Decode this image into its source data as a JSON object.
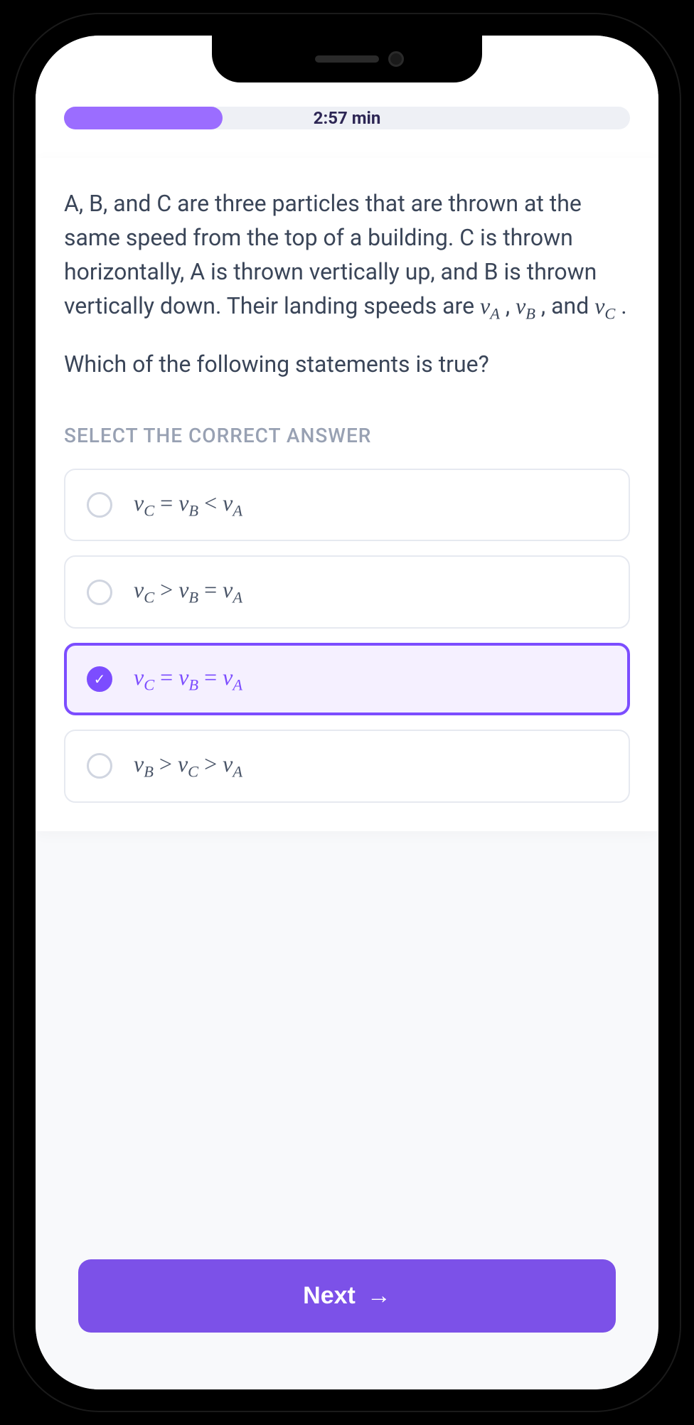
{
  "progress": {
    "timer": "2:57 min",
    "percent": 28
  },
  "question": {
    "body_pre": "A, B, and C are three particles that are thrown at the same speed from the top of a building. C is thrown horizontally, A is thrown vertically up, and B is thrown vertically down. Their landing speeds are ",
    "var_a": "v",
    "sub_a": "A",
    "var_b": "v",
    "sub_b": "B",
    "var_c": "v",
    "sub_c": "C",
    "sep": " , ",
    "and": " , and ",
    "end": " .",
    "prompt": "Which of the following statements is true?"
  },
  "instruction": "SELECT THE CORRECT ANSWER",
  "options": [
    {
      "v1": "v",
      "s1": "C",
      "op1": "=",
      "v2": "v",
      "s2": "B",
      "op2": "<",
      "v3": "v",
      "s3": "A",
      "selected": false
    },
    {
      "v1": "v",
      "s1": "C",
      "op1": ">",
      "v2": "v",
      "s2": "B",
      "op2": "=",
      "v3": "v",
      "s3": "A",
      "selected": false
    },
    {
      "v1": "v",
      "s1": "C",
      "op1": "=",
      "v2": "v",
      "s2": "B",
      "op2": "=",
      "v3": "v",
      "s3": "A",
      "selected": true
    },
    {
      "v1": "v",
      "s1": "B",
      "op1": ">",
      "v2": "v",
      "s2": "C",
      "op2": ">",
      "v3": "v",
      "s3": "A",
      "selected": false
    }
  ],
  "buttons": {
    "next": "Next"
  }
}
